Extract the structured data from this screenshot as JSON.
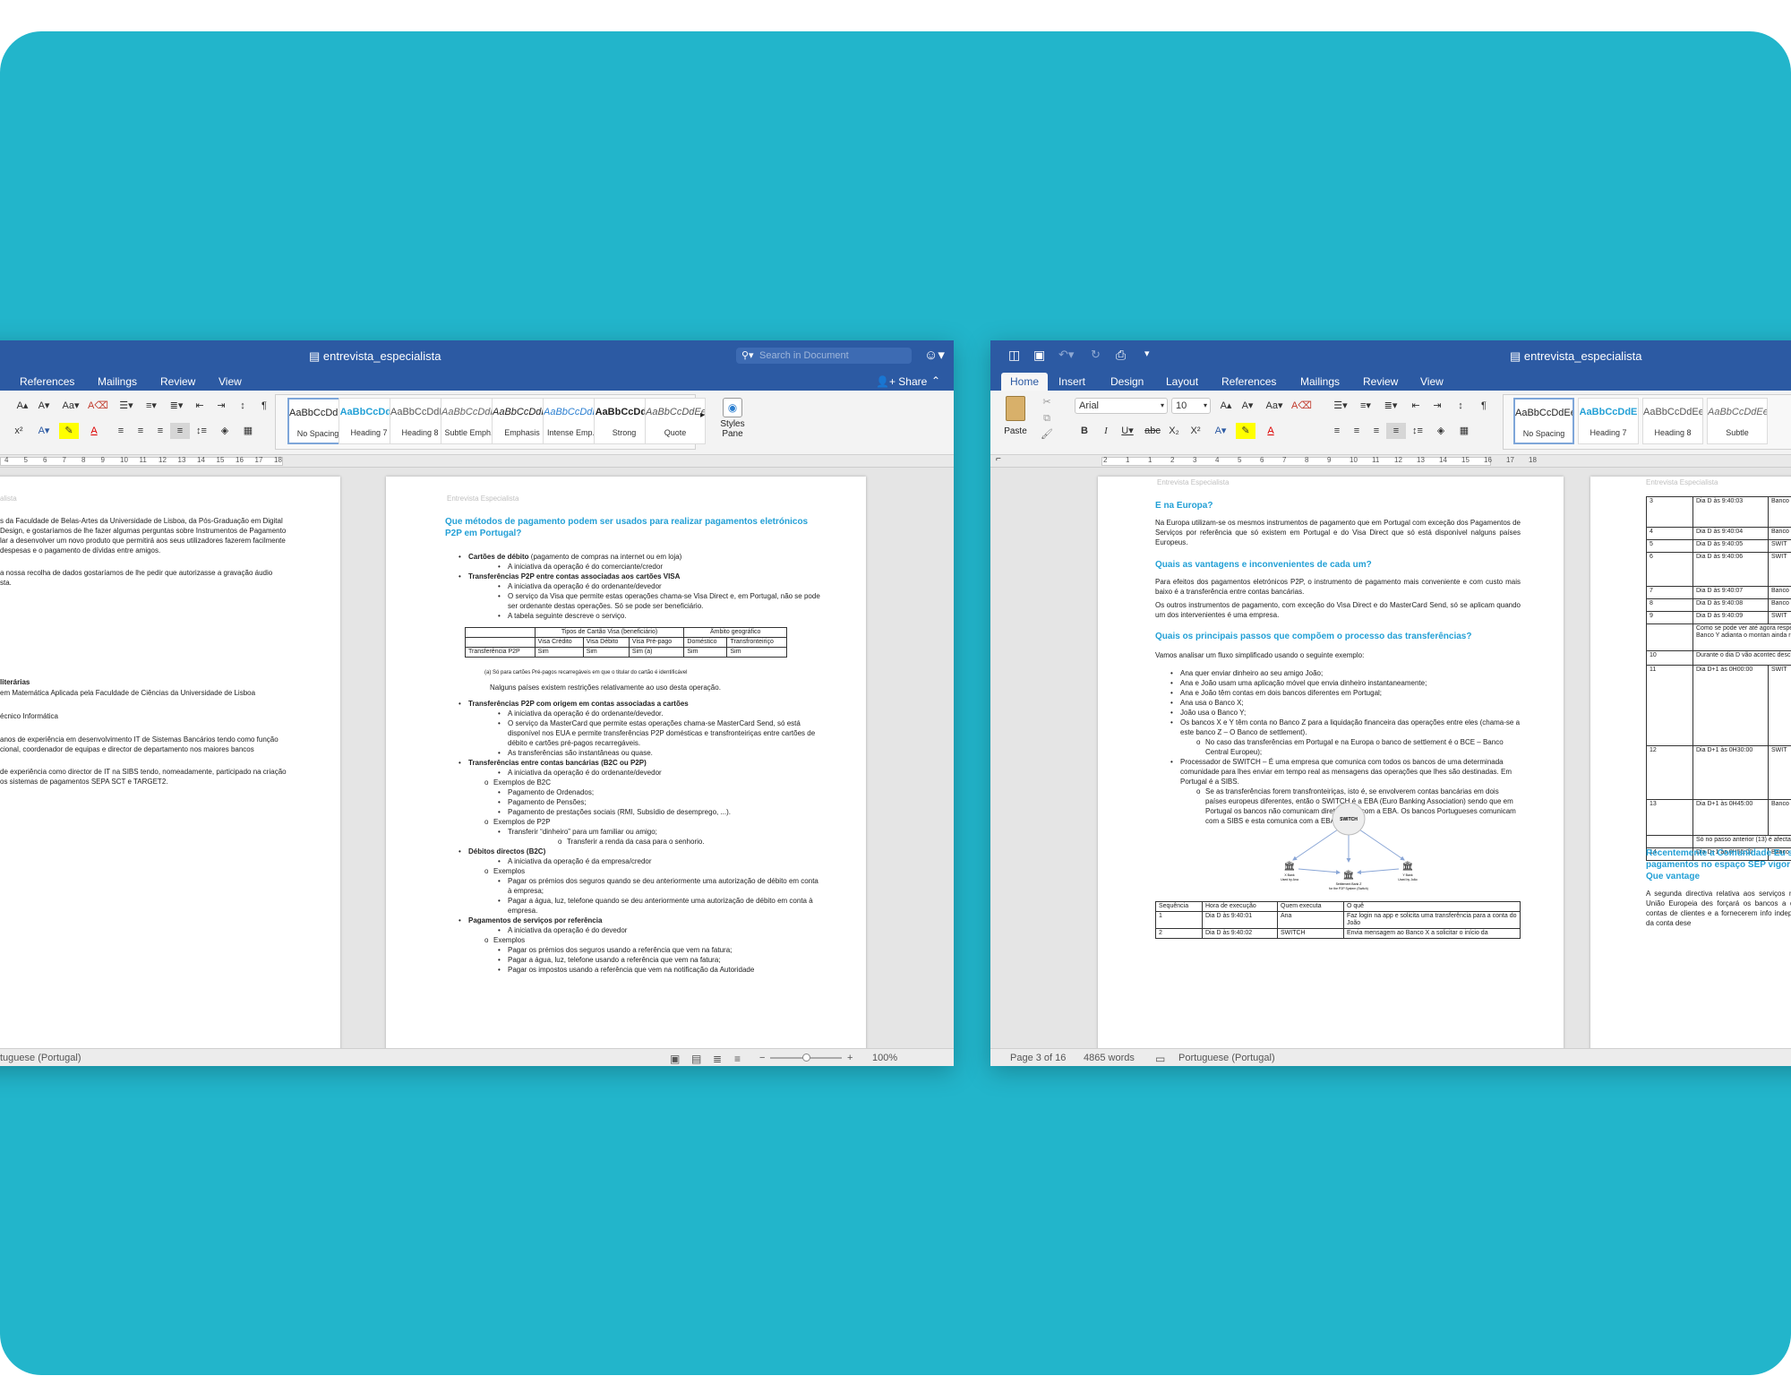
{
  "window_left": {
    "title": "entrevista_especialista",
    "search_placeholder": "Search in Document",
    "share_label": "Share",
    "tabs": [
      "References",
      "Mailings",
      "Review",
      "View"
    ],
    "styles": [
      {
        "preview": "AaBbCcDdEe",
        "name": "No Spacing"
      },
      {
        "preview": "AaBbCcDdE",
        "name": "Heading 7"
      },
      {
        "preview": "AaBbCcDdEe",
        "name": "Heading 8"
      },
      {
        "preview": "AaBbCcDdEe",
        "name": "Subtle Emph..."
      },
      {
        "preview": "AaBbCcDdEe",
        "name": "Emphasis"
      },
      {
        "preview": "AaBbCcDdEe",
        "name": "Intense Emp..."
      },
      {
        "preview": "AaBbCcDdE",
        "name": "Strong"
      },
      {
        "preview": "AaBbCcDdEe",
        "name": "Quote"
      }
    ],
    "styles_pane": "Styles Pane",
    "ruler": [
      "4",
      "5",
      "6",
      "7",
      "8",
      "9",
      "10",
      "11",
      "12",
      "13",
      "14",
      "15",
      "16",
      "17",
      "18"
    ],
    "status": {
      "language": "tuguese (Portugal)",
      "zoom": "100%"
    },
    "page1": {
      "header": "alista",
      "lines": [
        "s da Faculdade de Belas-Artes da Universidade de Lisboa, da Pós-Graduação em Digital",
        "Design, e gostaríamos de lhe fazer algumas perguntas sobre Instrumentos de Pagamento",
        "lar a desenvolver um novo produto que permitirá aos seus utilizadores fazerem facilmente",
        "despesas e o pagamento de dívidas entre amigos.",
        "a nossa recolha de dados gostaríamos de lhe pedir que autorizasse a gravação áudio",
        "sta.",
        "literárias",
        "em Matemática Aplicada pela Faculdade de Ciências da Universidade de Lisboa",
        "écnico Informática",
        "anos de experiência em desenvolvimento IT de Sistemas Bancários tendo como função",
        "cional, coordenador de equipas e director de departamento nos maiores bancos",
        "de experiência como director de IT na SIBS tendo, nomeadamente, participado na criação",
        "os sistemas de pagamentos SEPA SCT e TARGET2."
      ]
    },
    "page2": {
      "header": "Entrevista Especialista",
      "heading": "Que métodos de pagamento podem ser usados para realizar pagamentos eletrónicos P2P em Portugal?",
      "bullets1": [
        {
          "c": "l1",
          "b": "Cartões de débito",
          "t": " (pagamento de compras na internet ou em loja)"
        },
        {
          "c": "l2",
          "t": "A iniciativa da operação é do comerciante/credor"
        },
        {
          "c": "l1",
          "b": "Transferências P2P entre contas associadas aos cartões VISA",
          "t": ""
        },
        {
          "c": "l2",
          "t": "A iniciativa da operação é do ordenante/devedor"
        },
        {
          "c": "l2",
          "t": "O serviço da Visa que permite estas operações chama-se Visa Direct e, em Portugal, não se pode ser ordenante destas operações. Só se pode ser beneficiário."
        },
        {
          "c": "l2",
          "t": "A tabela seguinte descreve o serviço."
        }
      ],
      "table": {
        "h1": [
          "",
          "Tipos de Cartão Visa (beneficiário)",
          "Âmbito geográfico"
        ],
        "h2": [
          "",
          "Visa Crédito",
          "Visa Débito",
          "Visa Pré-pago",
          "Doméstico",
          "Transfronteiriço"
        ],
        "row": [
          "Transferência P2P",
          "Sim",
          "Sim",
          "Sim (a)",
          "Sim",
          "Sim"
        ]
      },
      "footnote": "(a)   Só para cartões Pré-pagos recarregáveis em que o titular do cartão é identificável",
      "note": "Nalguns países existem restrições relativamente ao uso desta operação.",
      "bullets2": [
        {
          "c": "l1",
          "b": "Transferências P2P com origem em contas associadas a cartões",
          "t": ""
        },
        {
          "c": "l2",
          "t": "A iniciativa da operação é do ordenante/devedor."
        },
        {
          "c": "l2",
          "t": "O serviço da MasterCard que permite estas operações chama-se MasterCard Send, só está disponível nos EUA e permite transferências P2P domésticas e transfronteiriças entre cartões de débito e cartões pré-pagos recarregáveis."
        },
        {
          "c": "l2",
          "t": "As transferências são instantâneas ou quase."
        },
        {
          "c": "l1",
          "b": "Transferências entre contas bancárias (B2C ou P2P)",
          "t": ""
        },
        {
          "c": "l2",
          "t": "A iniciativa da operação é do ordenante/devedor"
        },
        {
          "c": "lo",
          "t": "Exemplos de B2C"
        },
        {
          "c": "l2",
          "t": "Pagamento de Ordenados;"
        },
        {
          "c": "l2",
          "t": "Pagamento de Pensões;"
        },
        {
          "c": "l2",
          "t": "Pagamento de prestações sociais (RMI, Subsídio de desemprego, ...)."
        },
        {
          "c": "lo",
          "t": "Exemplos de P2P"
        },
        {
          "c": "l2",
          "t": "Transferir “dinheiro” para um familiar ou amigo;"
        },
        {
          "c": "lp",
          "t": "Transferir a renda da casa para o senhorio."
        },
        {
          "c": "l1",
          "b": "Débitos directos (B2C)",
          "t": ""
        },
        {
          "c": "l2",
          "t": "A iniciativa da operação é da empresa/credor"
        },
        {
          "c": "lo",
          "t": "Exemplos"
        },
        {
          "c": "l2",
          "t": "Pagar os prémios dos seguros quando se deu anteriormente uma autorização de débito em conta à empresa;"
        },
        {
          "c": "l2",
          "t": "Pagar a água, luz, telefone quando se deu anteriormente uma autorização de débito em conta à empresa."
        },
        {
          "c": "l1",
          "b": "Pagamentos de serviços por referência",
          "t": ""
        },
        {
          "c": "l2",
          "t": "A iniciativa da operação é do devedor"
        },
        {
          "c": "lo",
          "t": "Exemplos"
        },
        {
          "c": "l2",
          "t": "Pagar os prémios dos seguros usando a referência que vem na fatura;"
        },
        {
          "c": "l2",
          "t": "Pagar a água, luz, telefone usando a referência que vem na fatura;"
        },
        {
          "c": "l2",
          "t": "Pagar os impostos usando a referência que vem na notificação da Autoridade"
        }
      ]
    }
  },
  "window_right": {
    "title": "entrevista_especialista",
    "tabs": [
      "Home",
      "Insert",
      "Design",
      "Layout",
      "References",
      "Mailings",
      "Review",
      "View"
    ],
    "paste": "Paste",
    "font": "Arial",
    "size": "10",
    "styles": [
      {
        "preview": "AaBbCcDdEe",
        "name": "No Spacing"
      },
      {
        "preview": "AaBbCcDdE",
        "name": "Heading 7"
      },
      {
        "preview": "AaBbCcDdEe",
        "name": "Heading 8"
      },
      {
        "preview": "AaBbCcDdEe",
        "name": "Subtle"
      }
    ],
    "ruler": [
      "2",
      "1",
      "1",
      "2",
      "3",
      "4",
      "5",
      "6",
      "7",
      "8",
      "9",
      "10",
      "11",
      "12",
      "13",
      "14",
      "15",
      "16",
      "17",
      "18"
    ],
    "status": {
      "page": "Page 3 of 16",
      "words": "4865 words",
      "language": "Portuguese (Portugal)"
    },
    "page3": {
      "header": "Entrevista Especialista",
      "h1": "E na Europa?",
      "p1": "Na Europa utilizam-se os mesmos instrumentos de pagamento que em Portugal com exceção dos Pagamentos de Serviços por referência que só existem em Portugal e do Visa Direct que só está disponível nalguns países Europeus.",
      "h2": "Quais as vantagens e inconvenientes de cada um?",
      "p2": "Para efeitos dos pagamentos eletrónicos P2P, o instrumento de pagamento mais conveniente e com custo mais baixo é a transferência entre contas bancárias.",
      "p3": "Os outros instrumentos de pagamento, com exceção do Visa Direct e do MasterCard Send, só se aplicam quando um dos intervenientes é uma empresa.",
      "h3": "Quais os principais passos que compõem o processo das transferências?",
      "p4": "Vamos analisar um fluxo simplificado usando o seguinte exemplo:",
      "bullets": [
        {
          "c": "l1",
          "t": "Ana quer enviar dinheiro ao seu amigo João;"
        },
        {
          "c": "l1",
          "t": "Ana e João usam uma aplicação móvel que envia dinheiro instantaneamente;"
        },
        {
          "c": "l1",
          "t": "Ana e João têm contas em dois bancos diferentes em Portugal;"
        },
        {
          "c": "l1",
          "t": "Ana usa o Banco X;"
        },
        {
          "c": "l1",
          "t": "João usa o Banco Y;"
        },
        {
          "c": "l1",
          "t": "Os bancos X e Y têm conta no Banco Z para a liquidação financeira das operações entre eles (chama-se a este banco Z – O Banco de settlement)."
        },
        {
          "c": "lo",
          "t": "No caso das transferências em Portugal e na Europa o banco de settlement é o BCE – Banco Central Europeu);"
        },
        {
          "c": "l1",
          "t": "Processador de SWITCH – É uma empresa que comunica com todos os bancos de uma determinada comunidade para lhes enviar em tempo real as mensagens das operações que lhes são destinadas. Em Portugal é a SIBS."
        },
        {
          "c": "lo",
          "t": "Se as transferências forem transfronteiriças, isto é, se envolverem contas bancárias em dois países europeus diferentes, então o SWITCH é a EBA (Euro Banking Association) sendo que em Portugal os bancos não comunicam diretamente com a EBA. Os bancos Portugueses comunicam com a SIBS e esta comunica com a EBA."
        }
      ],
      "diagram": {
        "switch": "SWITCH",
        "bank_x": "X Bank",
        "bank_x_sub": "Used by Ana",
        "bank_z": "Settlement Bank Z",
        "bank_z_sub": "for the P2P System (Switch)",
        "bank_y": "Y Bank",
        "bank_y_sub": "Used by João"
      },
      "table": {
        "head": [
          "Sequência",
          "Hora de execução",
          "Quem executa",
          "O quê"
        ],
        "rows": [
          [
            "1",
            "Dia D às 9:40:01",
            "Ana",
            "Faz login na app e solicita uma transferência para a conta do João"
          ],
          [
            "2",
            "Dia D às 9:40:02",
            "SWITCH",
            "Envia mensagem ao Banco X a solicitar o início da"
          ]
        ]
      }
    },
    "page4": {
      "header": "Entrevista Especialista",
      "rows": [
        [
          "3",
          "Dia D às 9:40:03",
          "Banco"
        ],
        [
          "4",
          "Dia D às 9:40:04",
          "Banco"
        ],
        [
          "5",
          "Dia D às 9:40:05",
          "SWIT"
        ],
        [
          "6",
          "Dia D às 9:40:06",
          "SWIT"
        ],
        [
          "7",
          "Dia D às 9:40:07",
          "Banco"
        ],
        [
          "8",
          "Dia D às 9:40:08",
          "Banco"
        ],
        [
          "9",
          "Dia D às 9:40:09",
          "SWIT"
        ],
        [
          "",
          "Como se pode ver até agora respetivos bancos acertado O Banco Y adianta o montan ainda recebido o dinheiro por",
          ""
        ],
        [
          "10",
          "Durante o dia D vão acontec descrita sendo que o SWITC",
          ""
        ],
        [
          "11",
          "Dia D+1 às 0H00:00",
          "SWIT"
        ],
        [
          "12",
          "Dia D+1 às 0H30:00",
          "SWIT"
        ],
        [
          "13",
          "Dia D+1 às 0H45:00",
          "Banco"
        ],
        [
          "",
          "Só no passo anterior (13) é afectados pelos movimentos",
          ""
        ],
        [
          "14",
          "Dia D+1 às 0H55:00",
          "Banco"
        ]
      ],
      "heading": "Recentemente a Comunidade Eu sobre pagamentos no espaço SEP vigor no fim de 2018. Que vantage",
      "para": "A segunda directiva relativa aos serviços nacionais em toda a União Europeia des forçará os bancos a darem acesso, atrav contas de clientes e a fornecerem info independentes se o titular da conta dese"
    }
  }
}
